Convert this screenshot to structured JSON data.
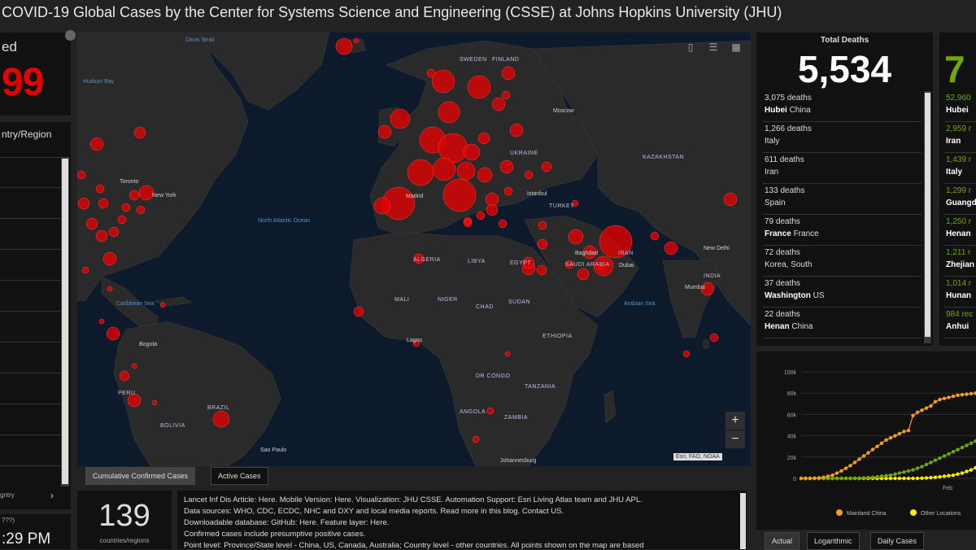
{
  "header": {
    "title": "COVID-19 Global Cases by the Center for Systems Science and Engineering (CSSE) at Johns Hopkins University (JHU)"
  },
  "left": {
    "confirmed_label": "ed",
    "confirmed_value": "99",
    "country_list_title": "ntry/Region",
    "bottom_text": "gntry",
    "time_small": "???)",
    "time_value": ":29 PM"
  },
  "map": {
    "colors": {
      "ocean": "#0c1a2b",
      "land": "#2a2a2a",
      "bubble": "#e60000"
    },
    "tabs": [
      "Cumulative Confirmed Cases",
      "Active Cases"
    ],
    "attribution": "Esri, FAO, NOAA",
    "zoom_in": "+",
    "zoom_out": "−",
    "country_labels": [
      "SWEDEN",
      "FINLAND",
      "UKRAINE",
      "KAZAKHSTAN",
      "ALGERIA",
      "LIBYA",
      "EGYPT",
      "MALI",
      "NIGER",
      "CHAD",
      "SUDAN",
      "TURKEY",
      "IRAN",
      "SAUDI ARABIA",
      "ETHIOPIA",
      "DR CONGO",
      "TANZANIA",
      "ANGOLA",
      "ZAMBIA",
      "BRAZIL",
      "PERU",
      "BOLIVIA",
      "INDIA"
    ],
    "ocean_labels": [
      "Davis Strait",
      "Hudson Bay",
      "North Atlantic Ocean",
      "Caribbean Sea",
      "Arabian Sea"
    ],
    "city_labels": [
      "Toronto",
      "New York",
      "Madrid",
      "Istanbul",
      "Baghdad",
      "Moscow",
      "Dubai",
      "New Delhi",
      "Mumbai",
      "Lagos",
      "Bogota",
      "Sao Paulo",
      "Johannesburg"
    ]
  },
  "count": {
    "value": "139",
    "label": "countries/regions"
  },
  "credits": {
    "lines": [
      "Lancet Inf Dis Article: Here. Mobile Version: Here. Visualization: JHU CSSE. Automation Support: Esri Living Atlas team and JHU APL.",
      "Data sources: WHO, CDC, ECDC, NHC and DXY and local media reports. Read more in this blog. Contact US.",
      "Downloadable database: GitHub: Here. Feature layer: Here.",
      "Confirmed cases include presumptive positive cases.",
      "Point level: Province/State level - China, US, Canada, Australia; Country level - other countries. All points shown on the map are based"
    ]
  },
  "deaths": {
    "title": "Total Deaths",
    "total": "5,534",
    "rows": [
      {
        "count": "3,075 deaths",
        "place": "Hubei",
        "region": "China"
      },
      {
        "count": "1,266 deaths",
        "place": "",
        "region": "Italy"
      },
      {
        "count": "611 deaths",
        "place": "",
        "region": "Iran"
      },
      {
        "count": "133 deaths",
        "place": "",
        "region": "Spain"
      },
      {
        "count": "79 deaths",
        "place": "France",
        "region": "France"
      },
      {
        "count": "72 deaths",
        "place": "",
        "region": "Korea, South"
      },
      {
        "count": "37 deaths",
        "place": "Washington",
        "region": "US"
      },
      {
        "count": "22 deaths",
        "place": "Henan",
        "region": "China"
      }
    ]
  },
  "recovered": {
    "total": "7",
    "rows": [
      {
        "count": "52,960",
        "place": "Hubei"
      },
      {
        "count": "2,959 r",
        "place": "Iran"
      },
      {
        "count": "1,439 r",
        "place": "Italy"
      },
      {
        "count": "1,299 r",
        "place": "Guangd"
      },
      {
        "count": "1,250 r",
        "place": "Henan"
      },
      {
        "count": "1,211 r",
        "place": "Zhejian"
      },
      {
        "count": "1,014 r",
        "place": "Hunan"
      },
      {
        "count": "984 rec",
        "place": "Anhui"
      }
    ]
  },
  "chart_data": {
    "type": "line",
    "y_ticks": [
      "100k",
      "80k",
      "60k",
      "40k",
      "20k",
      "0"
    ],
    "ylim": [
      0,
      100000
    ],
    "x_tick": "Feb",
    "legend": [
      "Mainland China",
      "Other Locations"
    ],
    "colors": {
      "mainland": "#f0a020",
      "other": "#ffeb00",
      "third": "#70a800"
    },
    "series": [
      {
        "name": "Mainland China",
        "color": "#f0a020",
        "values": [
          0,
          0,
          100,
          300,
          500,
          1000,
          2000,
          3000,
          5000,
          7000,
          9500,
          12000,
          15000,
          18000,
          21000,
          24000,
          27000,
          30000,
          33000,
          36000,
          38000,
          40000,
          42000,
          44000,
          45000,
          59000,
          62000,
          64000,
          66000,
          68000,
          72000,
          74000,
          75000,
          76000,
          77000,
          78000,
          78500,
          79000,
          79500,
          80000,
          80500
        ]
      },
      {
        "name": "",
        "color": "#70a800",
        "values": [
          0,
          0,
          0,
          0,
          0,
          0,
          0,
          0,
          0,
          0,
          0,
          100,
          200,
          300,
          500,
          800,
          1000,
          1500,
          2000,
          2500,
          3000,
          4000,
          5000,
          6000,
          7000,
          8000,
          9500,
          11000,
          13000,
          15000,
          17000,
          19000,
          21000,
          23000,
          25000,
          27000,
          29000,
          31000,
          33000,
          35000,
          37000
        ]
      },
      {
        "name": "Other Locations",
        "color": "#ffeb00",
        "values": [
          0,
          0,
          0,
          0,
          0,
          0,
          0,
          0,
          0,
          0,
          0,
          0,
          0,
          0,
          0,
          0,
          0,
          0,
          0,
          0,
          0,
          0,
          0,
          0,
          0,
          0,
          100,
          200,
          400,
          700,
          1000,
          1500,
          2000,
          2500,
          3000,
          4000,
          5000,
          6500,
          8000,
          10000,
          12000
        ]
      }
    ]
  },
  "chart_tabs": [
    "Actual",
    "Logarithmic",
    "Daily Cases"
  ]
}
